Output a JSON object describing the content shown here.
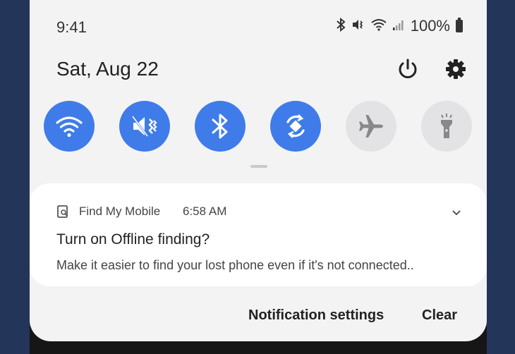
{
  "status_bar": {
    "time": "9:41",
    "battery": "100%"
  },
  "header": {
    "date": "Sat, Aug 22"
  },
  "quick_toggles": [
    {
      "name": "wifi",
      "state": "on",
      "icon": "wifi-icon"
    },
    {
      "name": "sound",
      "state": "on",
      "icon": "vibrate-icon"
    },
    {
      "name": "bluetooth",
      "state": "on",
      "icon": "bluetooth-icon"
    },
    {
      "name": "auto-rotate",
      "state": "on",
      "icon": "rotate-icon"
    },
    {
      "name": "airplane-mode",
      "state": "off",
      "icon": "airplane-icon"
    },
    {
      "name": "flashlight",
      "state": "off",
      "icon": "flashlight-icon"
    }
  ],
  "notification": {
    "app_name": "Find My Mobile",
    "time": "6:58 AM",
    "title": "Turn on Offline finding?",
    "body": "Make it easier to find your lost phone even if it's not connected.."
  },
  "actions": {
    "settings_label": "Notification settings",
    "clear_label": "Clear"
  },
  "colors": {
    "accent": "#3f7ce9",
    "panel": "#f3f3f4",
    "toggle_off": "#e3e3e5"
  }
}
